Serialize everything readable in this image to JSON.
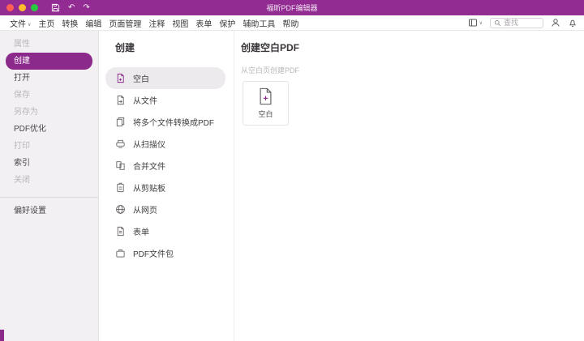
{
  "colors": {
    "brand_purple": "#8b2a8b",
    "titlebar_purple": "#922b92",
    "traffic_red": "#ff5f57",
    "traffic_yellow": "#febc2e",
    "traffic_green": "#28c840"
  },
  "titlebar": {
    "title": "福昕PDF编辑器",
    "undo_glyph": "↶",
    "redo_glyph": "↷"
  },
  "menubar": {
    "items": [
      "文件",
      "主页",
      "转换",
      "编辑",
      "页面管理",
      "注释",
      "视图",
      "表单",
      "保护",
      "辅助工具",
      "帮助"
    ],
    "file_caret": "∨",
    "view_caret": "∨",
    "search_placeholder": "查找"
  },
  "sidebar": {
    "items": [
      {
        "label": "属性",
        "state": "disabled"
      },
      {
        "label": "创建",
        "state": "selected"
      },
      {
        "label": "打开",
        "state": "normal"
      },
      {
        "label": "保存",
        "state": "disabled"
      },
      {
        "label": "另存为",
        "state": "disabled"
      },
      {
        "label": "PDF优化",
        "state": "normal"
      },
      {
        "label": "打印",
        "state": "disabled"
      },
      {
        "label": "索引",
        "state": "normal"
      },
      {
        "label": "关闭",
        "state": "disabled"
      }
    ],
    "preferences": "偏好设置"
  },
  "create_panel": {
    "title": "创建",
    "items": [
      {
        "label": "空白",
        "icon": "blank-doc-icon",
        "selected": true
      },
      {
        "label": "从文件",
        "icon": "from-file-icon",
        "selected": false
      },
      {
        "label": "将多个文件转换成PDF",
        "icon": "multiple-files-icon",
        "selected": false
      },
      {
        "label": "从扫描仪",
        "icon": "scanner-icon",
        "selected": false
      },
      {
        "label": "合并文件",
        "icon": "combine-files-icon",
        "selected": false
      },
      {
        "label": "从剪贴板",
        "icon": "clipboard-icon",
        "selected": false
      },
      {
        "label": "从网页",
        "icon": "web-page-icon",
        "selected": false
      },
      {
        "label": "表单",
        "icon": "form-icon",
        "selected": false
      },
      {
        "label": "PDF文件包",
        "icon": "pdf-portfolio-icon",
        "selected": false
      }
    ]
  },
  "detail_panel": {
    "title": "创建空白PDF",
    "subtitle": "从空白页创建PDF",
    "card_label": "空白"
  }
}
